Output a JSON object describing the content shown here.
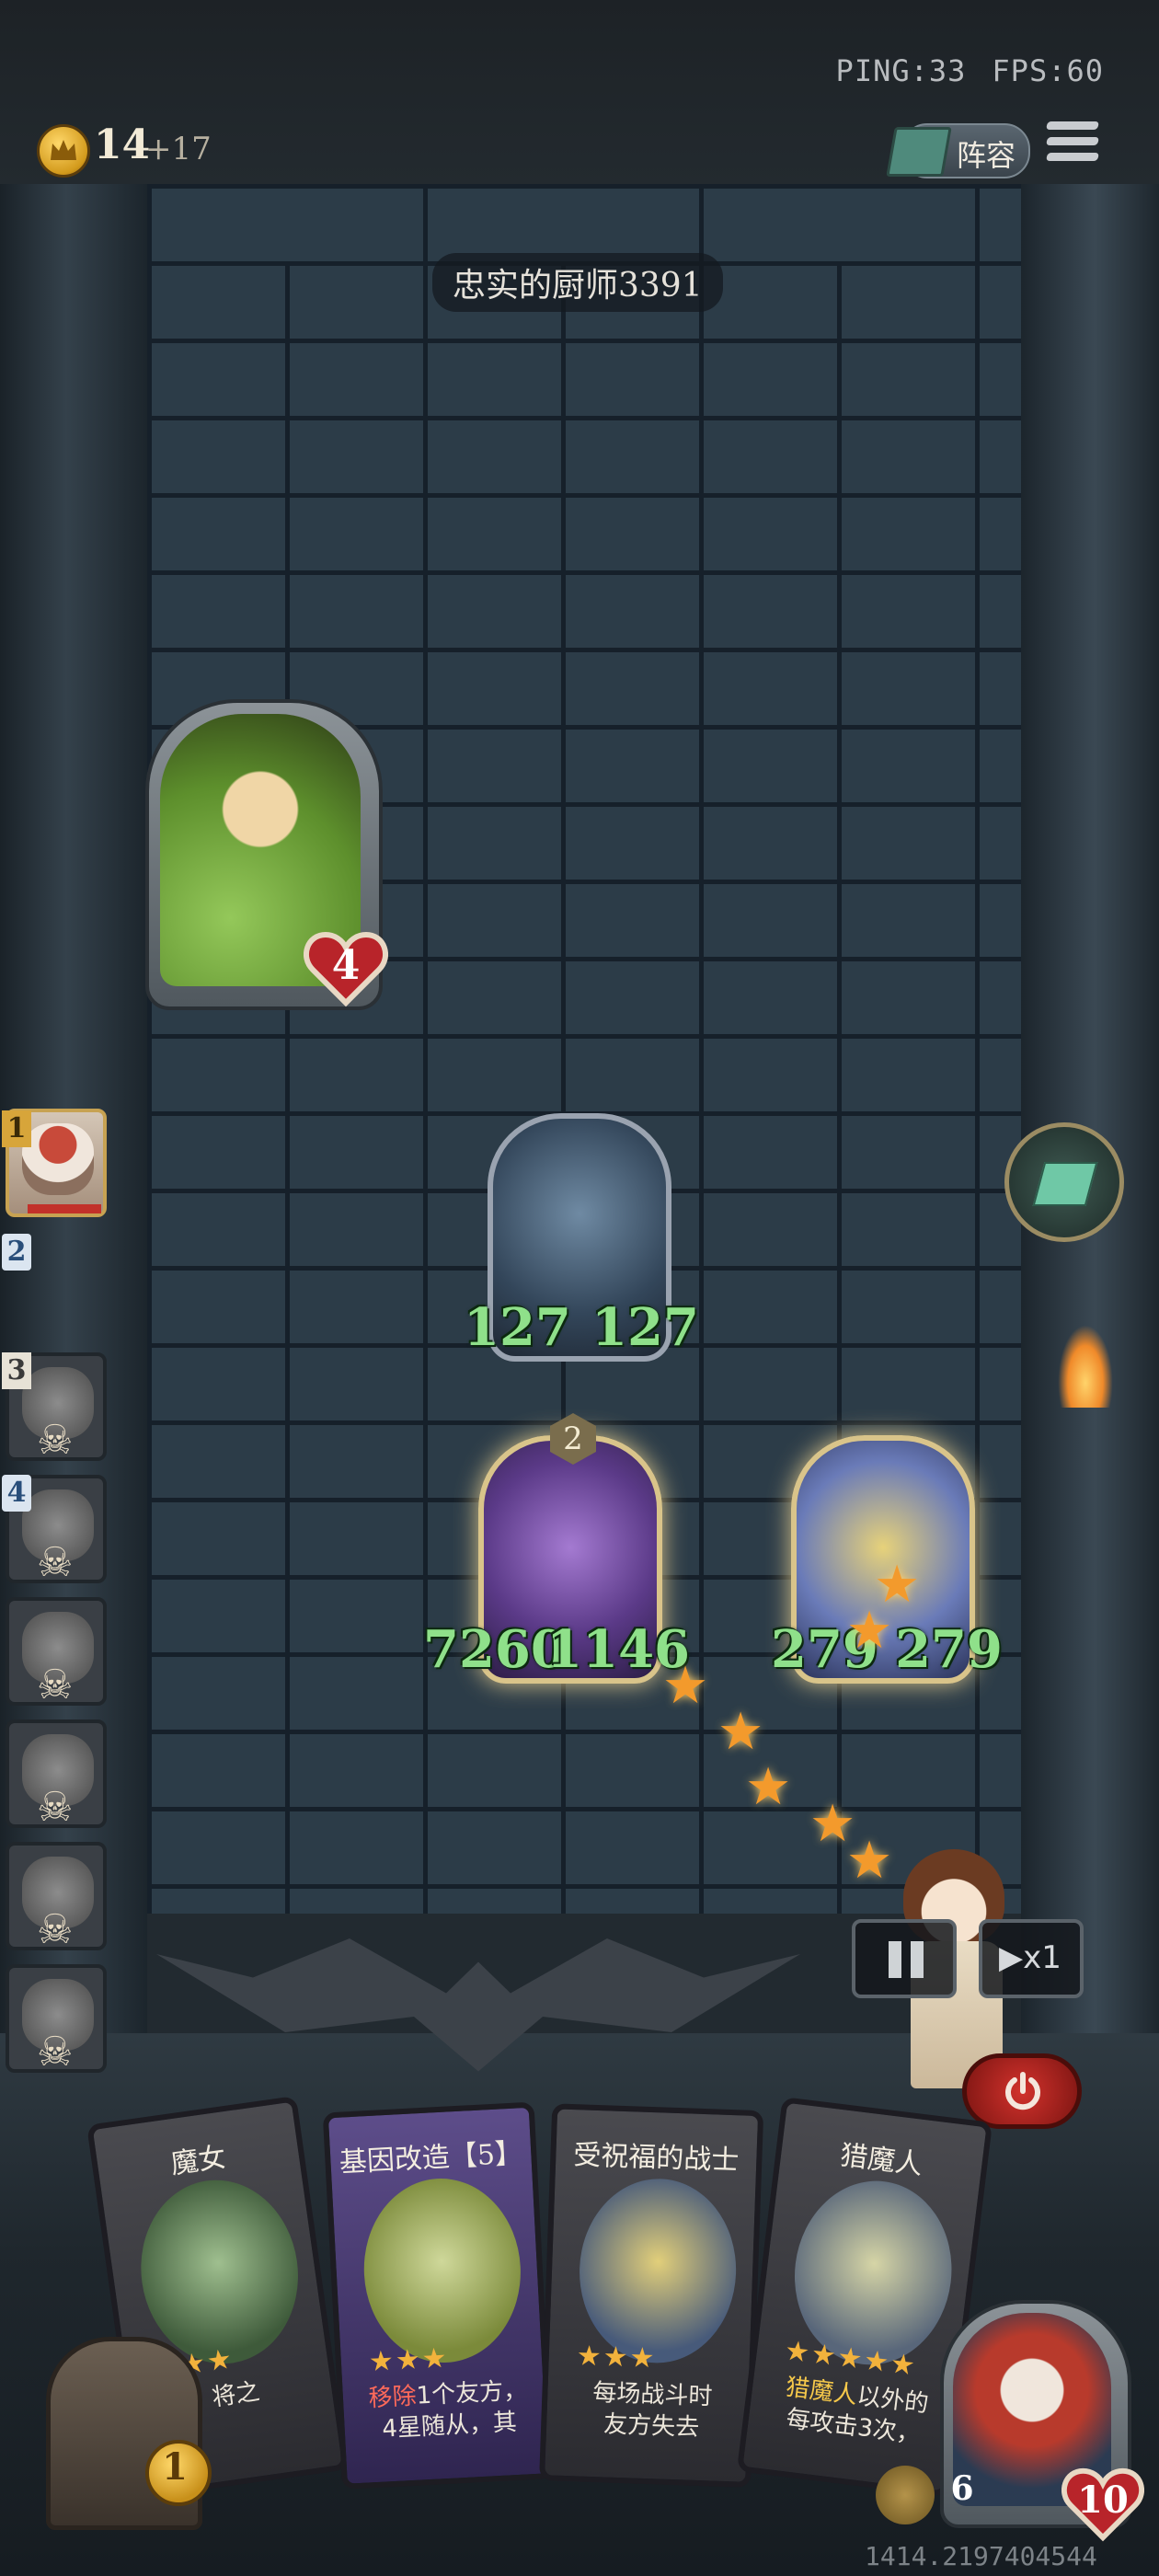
{
  "network": {
    "ping": "PING:33",
    "fps": "FPS:60"
  },
  "header": {
    "gold": "14",
    "gold_gain": "+17",
    "lineup_label": "阵容"
  },
  "opponent": {
    "name": "忠实的厨师3391",
    "hero_health": "4"
  },
  "board": {
    "minions": [
      {
        "name": "pirate",
        "attack": "127",
        "health": "127"
      },
      {
        "name": "demon-hunter",
        "attack": "7260",
        "health": "1146",
        "level": "2"
      },
      {
        "name": "blessed-knight",
        "attack": "279",
        "health": "279"
      }
    ]
  },
  "opponent_list": [
    {
      "rank": "1",
      "status": "active"
    },
    {
      "rank": "2",
      "status": "empty"
    },
    {
      "rank": "3",
      "status": "dead"
    },
    {
      "rank": "4",
      "status": "dead"
    },
    {
      "rank": "",
      "status": "dead"
    },
    {
      "rank": "",
      "status": "dead"
    },
    {
      "rank": "",
      "status": "dead"
    },
    {
      "rank": "",
      "status": "dead"
    }
  ],
  "controls": {
    "speed_label": "x1"
  },
  "hand": [
    {
      "title": "魔女",
      "stars": "★★★",
      "text_a": "将之",
      "text_b": ""
    },
    {
      "title": "基因改造【5】",
      "stars": "★★★",
      "text_a": "移除",
      "text_a2": "1个友方，",
      "text_b": "4星随从，其"
    },
    {
      "title": "受祝福的战士",
      "stars": "★★★",
      "text_a": "每场战斗时",
      "text_b": "友方失去"
    },
    {
      "title": "猎魔人",
      "stars": "★★★★★",
      "text_a": "猎魔人",
      "text_a2": "以外的",
      "text_b": "每攻击3次，"
    }
  ],
  "shop": {
    "tavern_level": "1"
  },
  "player": {
    "armor": "6",
    "health": "10"
  },
  "coordinates": "1414.2197404544",
  "colors": {
    "accent_gold": "#d7a53a",
    "attack_green": "#8fe08a",
    "danger_red": "#c2312a"
  }
}
